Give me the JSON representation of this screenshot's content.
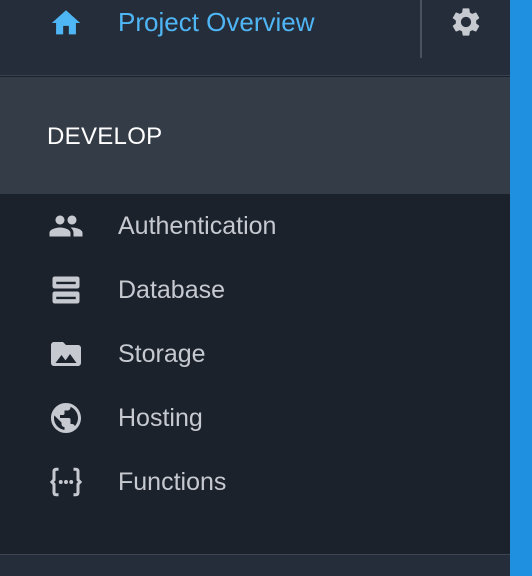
{
  "header": {
    "project_title": "Project Overview",
    "home_icon": "home-icon",
    "settings_icon": "gear-icon"
  },
  "section": {
    "label": "DEVELOP"
  },
  "nav": {
    "items": [
      {
        "label": "Authentication",
        "icon": "people-icon"
      },
      {
        "label": "Database",
        "icon": "database-icon"
      },
      {
        "label": "Storage",
        "icon": "folder-image-icon"
      },
      {
        "label": "Hosting",
        "icon": "globe-icon"
      },
      {
        "label": "Functions",
        "icon": "functions-icon"
      }
    ]
  },
  "colors": {
    "accent": "#4fb6f5",
    "sidebar_bg": "#1c222c",
    "top_bar_bg": "#262d3a",
    "section_bg": "#343c47",
    "nav_text": "#c6cad0",
    "right_edge": "#1f8fe0"
  }
}
